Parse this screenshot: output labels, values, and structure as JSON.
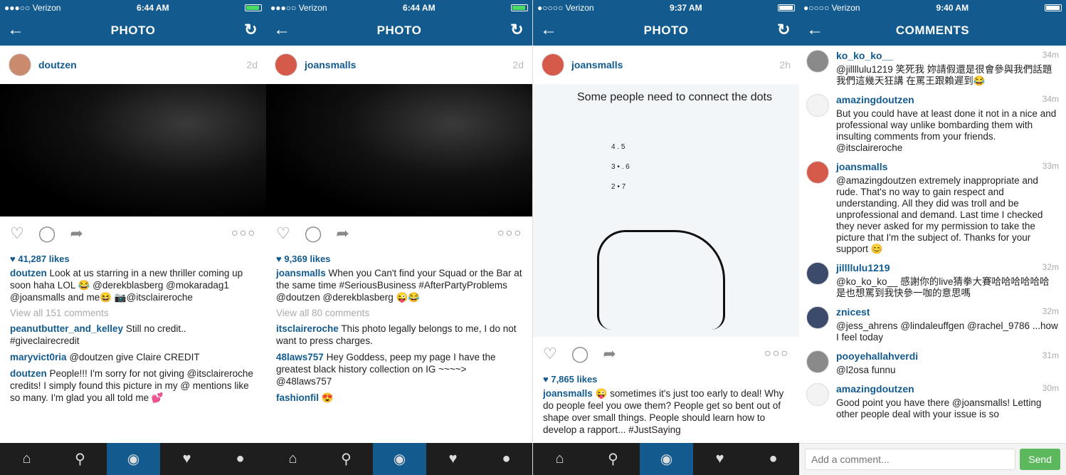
{
  "screens": [
    {
      "status": {
        "carrier": "●●●○○ Verizon",
        "time": "6:44 AM"
      },
      "nav": {
        "title": "PHOTO"
      },
      "post": {
        "user": "doutzen",
        "time": "2d",
        "likes": "41,287 likes",
        "caption": "Look at us starring in a new thriller coming up soon haha LOL 😂 @derekblasberg @mokaradag1 @joansmalls and me😆 📷@itsclaireroche",
        "view_all": "View all 151 comments",
        "comments": [
          {
            "user": "peanutbutter_and_kelley",
            "text": "Still no credit.. #giveclairecredit"
          },
          {
            "user": "maryvict0ria",
            "text": "@doutzen give Claire CREDIT"
          },
          {
            "user": "doutzen",
            "text": "People!!! I'm sorry for not giving @itsclaireroche credits! I simply found this picture in my @ mentions like so many. I'm glad you all told me 💕"
          }
        ]
      }
    },
    {
      "status": {
        "carrier": "●●●○○ Verizon",
        "time": "6:44 AM"
      },
      "nav": {
        "title": "PHOTO"
      },
      "post": {
        "user": "joansmalls",
        "time": "2d",
        "likes": "9,369 likes",
        "caption": "When you Can't find your Squad or the Bar at the same time #SeriousBusiness #AfterPartyProblems @doutzen @derekblasberg 😜😂",
        "view_all": "View all 80 comments",
        "comments": [
          {
            "user": "itsclaireroche",
            "text": "This photo legally belongs to me, I do not want to press charges."
          },
          {
            "user": "48laws757",
            "text": "Hey Goddess, peep my page I have the greatest black history collection on IG ~~~~> @48laws757"
          },
          {
            "user": "fashionfil",
            "text": "😍"
          }
        ]
      }
    },
    {
      "status": {
        "carrier": "●○○○○ Verizon",
        "time": "9:37 AM"
      },
      "nav": {
        "title": "PHOTO"
      },
      "post": {
        "user": "joansmalls",
        "time": "2h",
        "image_text": "Some people need to connect the dots",
        "dots": "4 . 5\n3 • . 6\n2 • 7",
        "likes": "7,865 likes",
        "caption": "😜 sometimes it's just too early to deal! Why do people feel you owe them? People get so bent out of shape over small things. People should learn how to develop a rapport... #JustSaying"
      }
    },
    {
      "status": {
        "carrier": "●○○○○ Verizon",
        "time": "9:40 AM"
      },
      "nav": {
        "title": "COMMENTS"
      },
      "comments": [
        {
          "user": "ko_ko_ko__",
          "time": "34m",
          "text": "@jillllulu1219 笑死我 妳請假還是很會參與我們話題 我們這幾天狂講 在罵王跟賴遲到😂"
        },
        {
          "user": "amazingdoutzen",
          "time": "34m",
          "text": "But you could have at least done it not in a nice and professional way unlike bombarding them with insulting comments from your friends. @itsclaireroche"
        },
        {
          "user": "joansmalls",
          "time": "33m",
          "text": "@amazingdoutzen extremely inappropriate and rude. That's no way to gain respect and understanding. All they did was troll and be unprofessional and demand. Last time I checked they never asked for my permission to take the picture that I'm the subject of. Thanks for your support 😊"
        },
        {
          "user": "jillllulu1219",
          "time": "32m",
          "text": "@ko_ko_ko__ 感謝你的live猜拳大賽哈哈哈哈哈哈是也想罵到我快參一咖的意思嗎"
        },
        {
          "user": "znicest",
          "time": "32m",
          "text": "@jess_ahrens @lindaleuffgen @rachel_9786 ...how I feel today"
        },
        {
          "user": "pooyehallahverdi",
          "time": "31m",
          "text": "@l2osa funnu"
        },
        {
          "user": "amazingdoutzen",
          "time": "30m",
          "text": "Good point you have there @joansmalls! Letting other people deal with your issue is so"
        }
      ],
      "composer": {
        "placeholder": "Add a comment...",
        "send": "Send"
      }
    }
  ],
  "colors": {
    "accent": "#135b8f",
    "tabbar": "#1e1e1e",
    "send": "#5cb85c"
  }
}
